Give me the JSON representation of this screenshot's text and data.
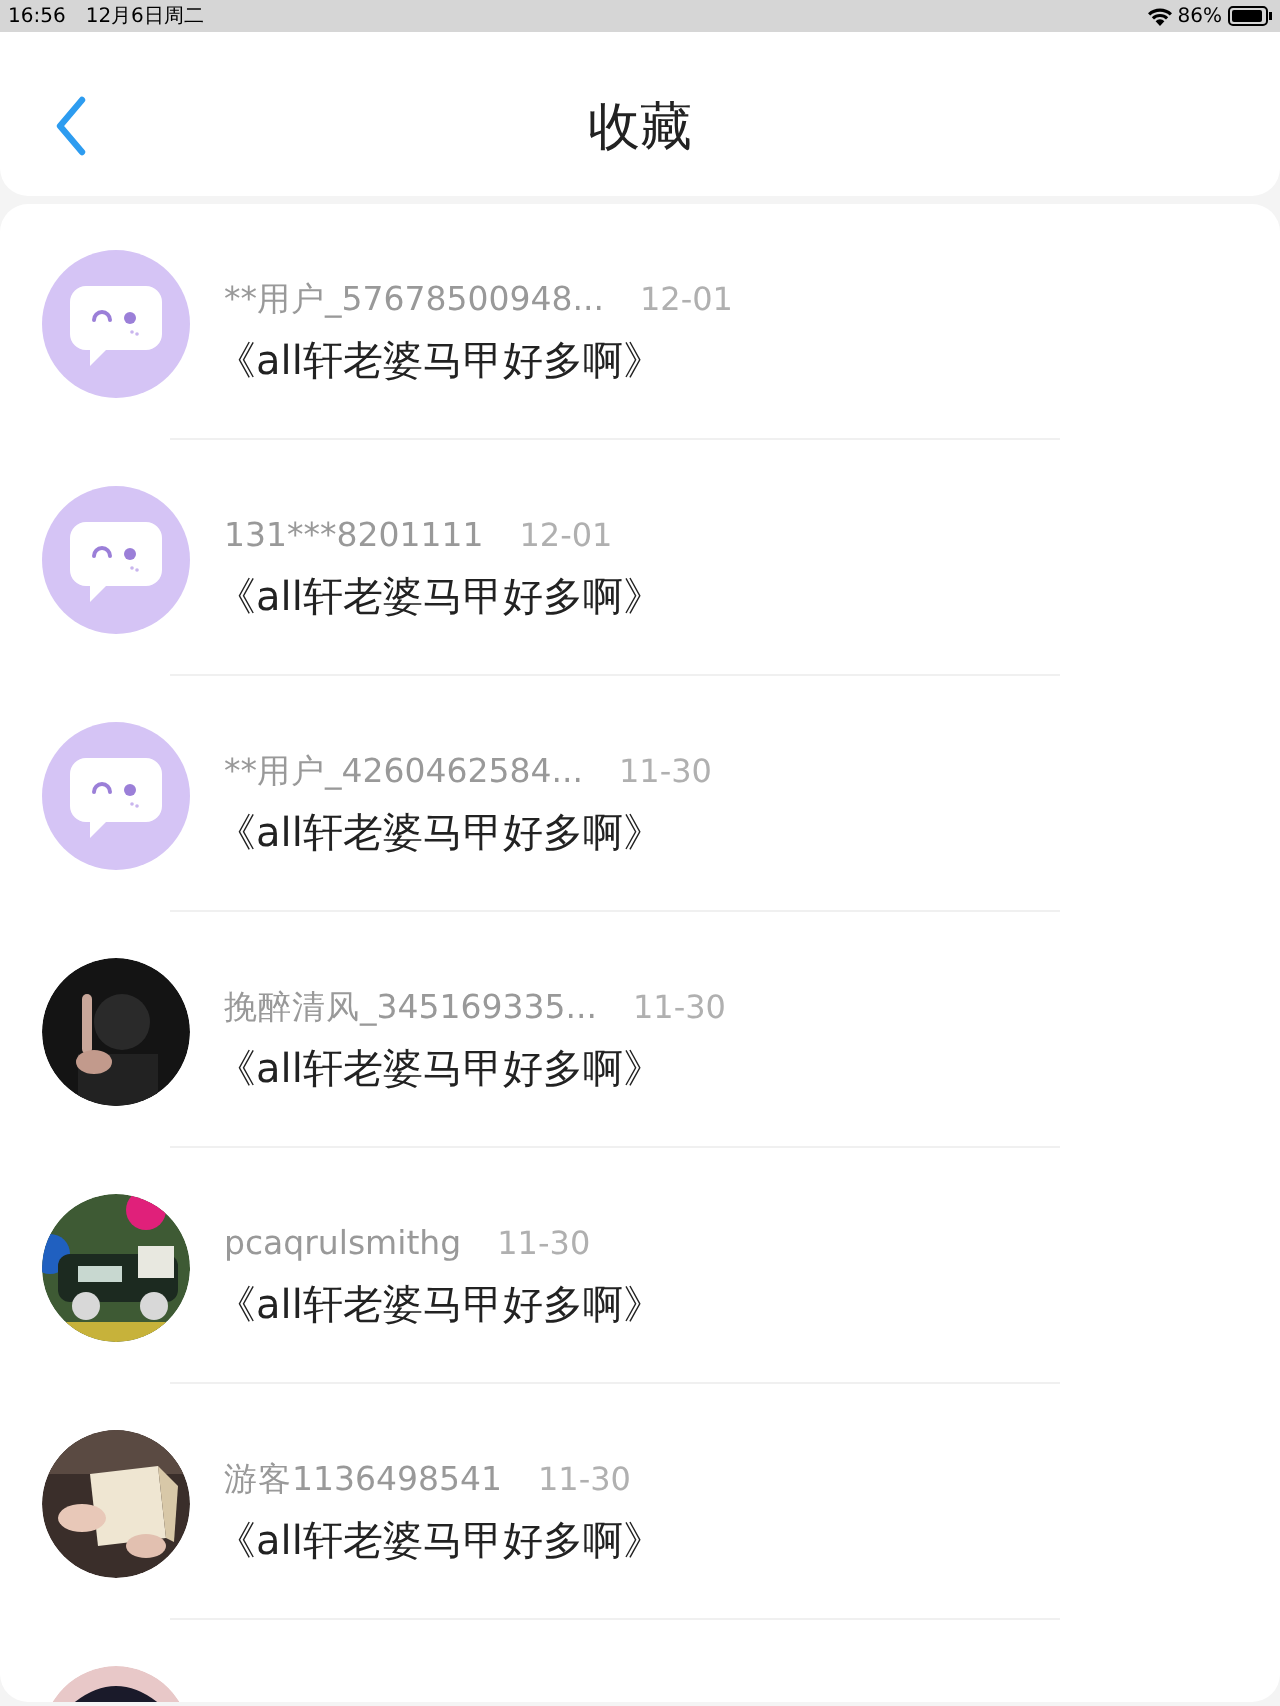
{
  "status_bar": {
    "time": "16:56",
    "date": "12月6日周二",
    "battery": "86%"
  },
  "header": {
    "title": "收藏"
  },
  "items": [
    {
      "avatar": {
        "kind": "default"
      },
      "user": "**用户_57678500948...",
      "date": "12-01",
      "title": "《all轩老婆马甲好多啊》"
    },
    {
      "avatar": {
        "kind": "default"
      },
      "user": "131***8201111",
      "date": "12-01",
      "title": "《all轩老婆马甲好多啊》"
    },
    {
      "avatar": {
        "kind": "default"
      },
      "user": "**用户_4260462584...",
      "date": "11-30",
      "title": "《all轩老婆马甲好多啊》"
    },
    {
      "avatar": {
        "kind": "picture"
      },
      "user": "挽醉清风_345169335...",
      "date": "11-30",
      "title": "《all轩老婆马甲好多啊》"
    },
    {
      "avatar": {
        "kind": "picture"
      },
      "user": "pcaqrulsmithg",
      "date": "11-30",
      "title": "《all轩老婆马甲好多啊》"
    },
    {
      "avatar": {
        "kind": "picture"
      },
      "user": "游客1136498541",
      "date": "11-30",
      "title": "《all轩老婆马甲好多啊》"
    },
    {
      "avatar": {
        "kind": "picture"
      }
    }
  ]
}
